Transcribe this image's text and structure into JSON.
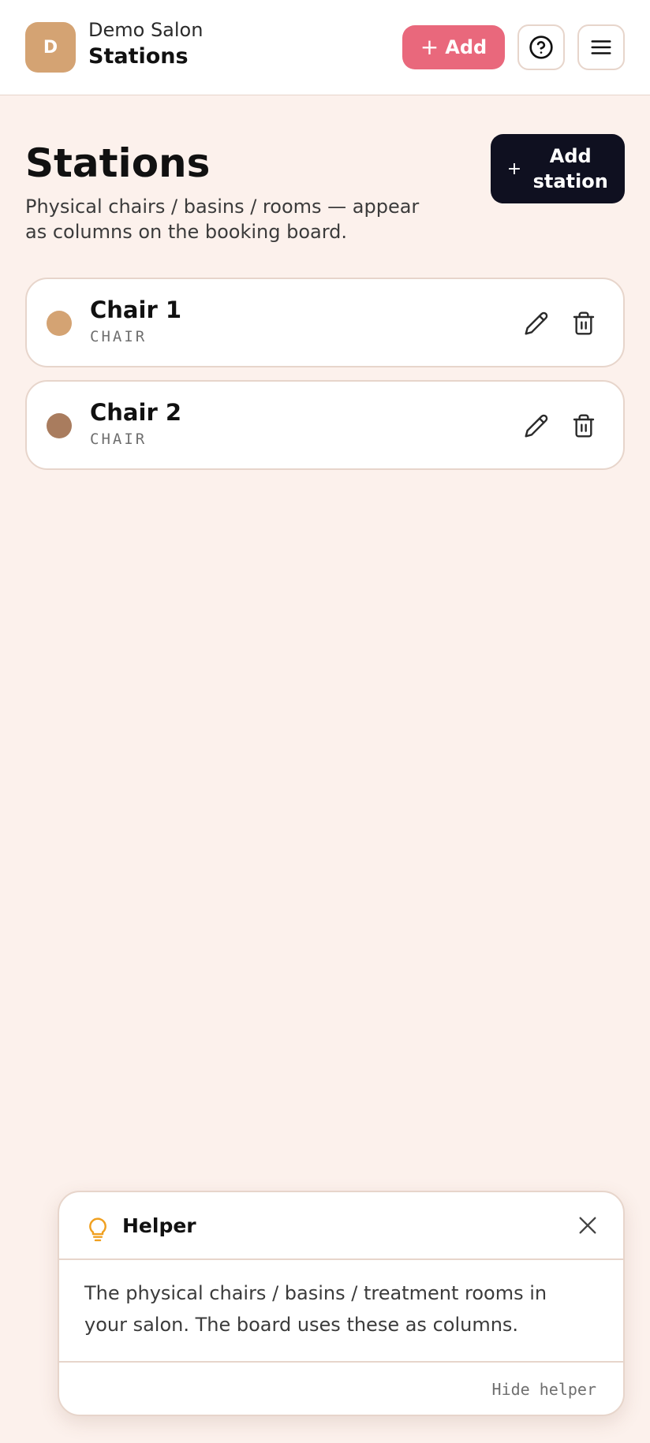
{
  "header": {
    "avatar_letter": "D",
    "salon_name": "Demo Salon",
    "page_name": "Stations",
    "add_button": {
      "plus": "+",
      "label": "Add"
    }
  },
  "main": {
    "title": "Stations",
    "description": "Physical chairs / basins / rooms — appear as columns on the booking board.",
    "add_station_button": {
      "plus": "+",
      "label": "Add station"
    },
    "stations": [
      {
        "name": "Chair 1",
        "type": "CHAIR",
        "color": "#d4a373"
      },
      {
        "name": "Chair 2",
        "type": "CHAIR",
        "color": "#a97c5e"
      }
    ]
  },
  "helper": {
    "title": "Helper",
    "body": "The physical chairs / basins / treatment rooms in your salon. The board uses these as columns.",
    "hide_label": "Hide helper"
  },
  "colors": {
    "accent_pink": "#e9687c",
    "dark_button": "#0f1020",
    "page_bg": "#fcf1ec",
    "border": "#e7d5cb",
    "bulb_yellow": "#f0a020"
  },
  "icons": [
    "help-circle-icon",
    "hamburger-menu-icon",
    "pencil-icon",
    "trash-icon",
    "lightbulb-icon",
    "close-icon"
  ]
}
